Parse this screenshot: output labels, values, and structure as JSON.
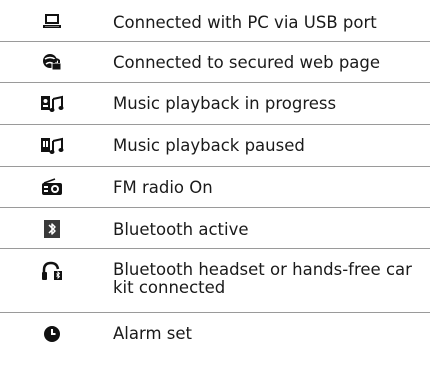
{
  "rows": [
    {
      "icon": "pc-usb-icon",
      "text": "Connected with PC via USB port"
    },
    {
      "icon": "secure-web-icon",
      "text": "Connected to secured web page"
    },
    {
      "icon": "music-playing-icon",
      "text": "Music playback in progress"
    },
    {
      "icon": "music-paused-icon",
      "text": "Music playback paused"
    },
    {
      "icon": "fm-radio-icon",
      "text": "FM radio On"
    },
    {
      "icon": "bluetooth-icon",
      "text": "Bluetooth active"
    },
    {
      "icon": "bt-headset-icon",
      "text": "Bluetooth headset or hands-free car kit connected"
    },
    {
      "icon": "alarm-icon",
      "text": "Alarm set"
    }
  ],
  "colors": {
    "divider": "#9a9a9a",
    "icon": "#111111"
  }
}
